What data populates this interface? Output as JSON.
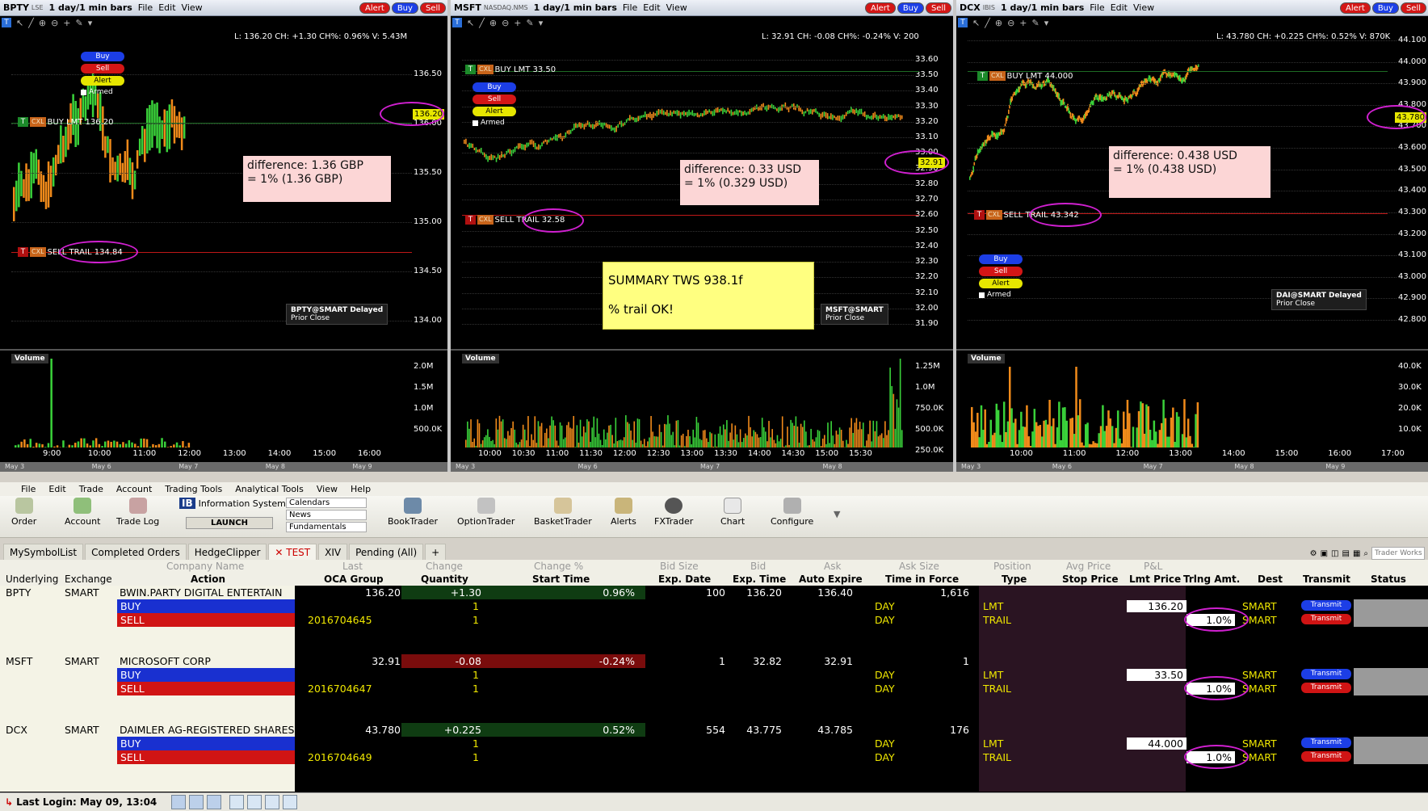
{
  "charts": [
    {
      "symbol": "BPTY",
      "exchange": "LSE",
      "timeframe": "1 day/1 min bars",
      "menu": [
        "File",
        "Edit",
        "View"
      ],
      "buttons": [
        "Alert",
        "Buy",
        "Sell"
      ],
      "info": "L: 136.20 CH: +1.30 CH%: 0.96% V: 5.43M",
      "yticks": [
        "136.50",
        "136.00",
        "135.50",
        "135.00",
        "134.50",
        "134.00"
      ],
      "current": "136.20",
      "buy_order": "BUY LMT 136.20",
      "sell_order": "SELL TRAIL 134.84",
      "note": "difference: 1.36 GBP\n= 1% (1.36 GBP)",
      "legend": "BPTY@SMART Delayed",
      "prior_close": "Prior Close",
      "vol_label": "Volume",
      "vol_ticks": [
        "2.0M",
        "1.5M",
        "1.0M",
        "500.0K"
      ],
      "xticks": [
        "9:00",
        "10:00",
        "11:00",
        "12:00",
        "13:00",
        "14:00",
        "15:00",
        "16:00"
      ],
      "dates": [
        "May 3",
        "May 6",
        "May 7",
        "May 8",
        "May 9"
      ],
      "mini": [
        "Buy",
        "Sell",
        "Alert"
      ],
      "armed": "Armed"
    },
    {
      "symbol": "MSFT",
      "exchange": "NASDAQ.NMS",
      "timeframe": "1 day/1 min bars",
      "menu": [
        "File",
        "Edit",
        "View"
      ],
      "buttons": [
        "Alert",
        "Buy",
        "Sell"
      ],
      "info": "L: 32.91 CH: -0.08 CH%: -0.24% V: 200",
      "yticks": [
        "33.60",
        "33.50",
        "33.40",
        "33.30",
        "33.20",
        "33.10",
        "33.00",
        "32.90",
        "32.80",
        "32.70",
        "32.60",
        "32.50",
        "32.40",
        "32.30",
        "32.20",
        "32.10",
        "32.00",
        "31.90"
      ],
      "current": "32.91",
      "buy_order": "BUY LMT 33.50",
      "sell_order": "SELL TRAIL 32.58",
      "note": "difference: 0.33 USD\n= 1% (0.329 USD)",
      "legend": "MSFT@SMART",
      "prior_close": "Prior Close",
      "vol_label": "Volume",
      "vol_ticks": [
        "1.25M",
        "1.0M",
        "750.0K",
        "500.0K",
        "250.0K"
      ],
      "xticks": [
        "10:00",
        "10:30",
        "11:00",
        "11:30",
        "12:00",
        "12:30",
        "13:00",
        "13:30",
        "14:00",
        "14:30",
        "15:00",
        "15:30"
      ],
      "dates": [
        "May 3",
        "May 6",
        "May 7",
        "May 8"
      ],
      "mini": [
        "Buy",
        "Sell",
        "Alert"
      ],
      "armed": "Armed"
    },
    {
      "symbol": "DCX",
      "exchange": "IBIS",
      "timeframe": "1 day/1 min bars",
      "menu": [
        "File",
        "Edit",
        "View"
      ],
      "buttons": [
        "Alert",
        "Buy",
        "Sell"
      ],
      "info": "L: 43.780 CH: +0.225 CH%: 0.52% V: 870K",
      "yticks": [
        "44.100",
        "44.000",
        "43.900",
        "43.800",
        "43.700",
        "43.600",
        "43.500",
        "43.400",
        "43.300",
        "43.200",
        "43.100",
        "43.000",
        "42.900",
        "42.800"
      ],
      "current": "43.780",
      "buy_order": "BUY LMT 44.000",
      "sell_order": "SELL TRAIL 43.342",
      "note": "difference: 0.438 USD\n= 1% (0.438 USD)",
      "legend": "DAI@SMART Delayed",
      "prior_close": "Prior Close",
      "vol_label": "Volume",
      "vol_ticks": [
        "40.0K",
        "30.0K",
        "20.0K",
        "10.0K"
      ],
      "xticks": [
        "10:00",
        "11:00",
        "12:00",
        "13:00",
        "14:00",
        "15:00",
        "16:00",
        "17:00"
      ],
      "dates": [
        "May 3",
        "May 6",
        "May 7",
        "May 8",
        "May 9"
      ],
      "mini": [
        "Buy",
        "Sell",
        "Alert"
      ],
      "armed": "Armed"
    }
  ],
  "sticky": {
    "title": "SUMMARY TWS 938.1f",
    "body": "% trail OK!"
  },
  "menubar": [
    "File",
    "Edit",
    "Trade",
    "Account",
    "Trading Tools",
    "Analytical Tools",
    "View",
    "Help"
  ],
  "toolbar": {
    "order": "Order",
    "account": "Account",
    "tradelog": "Trade Log",
    "infosys": "Information System",
    "launch": "LAUNCH",
    "dd": [
      "Calendars",
      "News",
      "Fundamentals"
    ],
    "booktrader": "BookTrader",
    "optiontrader": "OptionTrader",
    "baskettrader": "BasketTrader",
    "alerts": "Alerts",
    "fxtrader": "FXTrader",
    "chart": "Chart",
    "configure": "Configure"
  },
  "tabs": [
    "MySymbolList",
    "Completed Orders",
    "HedgeClipper",
    "TEST",
    "XIV",
    "Pending (All)",
    "+"
  ],
  "tab_right": "Trader Works",
  "header1": [
    "Company Name",
    "Last",
    "Change",
    "Change %",
    "Bid Size",
    "Bid",
    "Ask",
    "Ask Size",
    "Position",
    "Avg Price",
    "P&L"
  ],
  "header2": [
    "Underlying",
    "Exchange",
    "Action",
    "OCA Group",
    "Quantity",
    "Start Time",
    "Exp. Date",
    "Exp. Time",
    "Auto Expire",
    "Time in Force",
    "Type",
    "Stop Price",
    "Lmt Price",
    "Trlng Amt.",
    "Dest",
    "Transmit",
    "Status"
  ],
  "rows": [
    {
      "sym": "BPTY",
      "exch": "SMART",
      "company": "BWIN.PARTY DIGITAL ENTERTAIN",
      "last": "136.20",
      "change": "+1.30",
      "changepct": "0.96%",
      "bidsize": "100",
      "bid": "136.20",
      "ask": "136.40",
      "asksize": "1,616",
      "buy": {
        "action": "BUY",
        "qty": "1",
        "tif": "DAY",
        "type": "LMT",
        "lmt": "136.20",
        "dest": "SMART",
        "transmit": "Transmit"
      },
      "sell": {
        "action": "SELL",
        "oca": "2016704645",
        "qty": "1",
        "tif": "DAY",
        "type": "TRAIL",
        "trl": "1.0%",
        "dest": "SMART",
        "transmit": "Transmit"
      }
    },
    {
      "sym": "MSFT",
      "exch": "SMART",
      "company": "MICROSOFT CORP",
      "last": "32.91",
      "change": "-0.08",
      "changepct": "-0.24%",
      "bidsize": "1",
      "bid": "32.82",
      "ask": "32.91",
      "asksize": "1",
      "buy": {
        "action": "BUY",
        "qty": "1",
        "tif": "DAY",
        "type": "LMT",
        "lmt": "33.50",
        "dest": "SMART",
        "transmit": "Transmit"
      },
      "sell": {
        "action": "SELL",
        "oca": "2016704647",
        "qty": "1",
        "tif": "DAY",
        "type": "TRAIL",
        "trl": "1.0%",
        "dest": "SMART",
        "transmit": "Transmit"
      }
    },
    {
      "sym": "DCX",
      "exch": "SMART",
      "company": "DAIMLER AG-REGISTERED SHARES",
      "last": "43.780",
      "change": "+0.225",
      "changepct": "0.52%",
      "bidsize": "554",
      "bid": "43.775",
      "ask": "43.785",
      "asksize": "176",
      "buy": {
        "action": "BUY",
        "qty": "1",
        "tif": "DAY",
        "type": "LMT",
        "lmt": "44.000",
        "dest": "SMART",
        "transmit": "Transmit"
      },
      "sell": {
        "action": "SELL",
        "oca": "2016704649",
        "qty": "1",
        "tif": "DAY",
        "type": "TRAIL",
        "trl": "1.0%",
        "dest": "SMART",
        "transmit": "Transmit"
      }
    }
  ],
  "statusbar": {
    "last_login": "Last Login: May 09, 13:04"
  }
}
